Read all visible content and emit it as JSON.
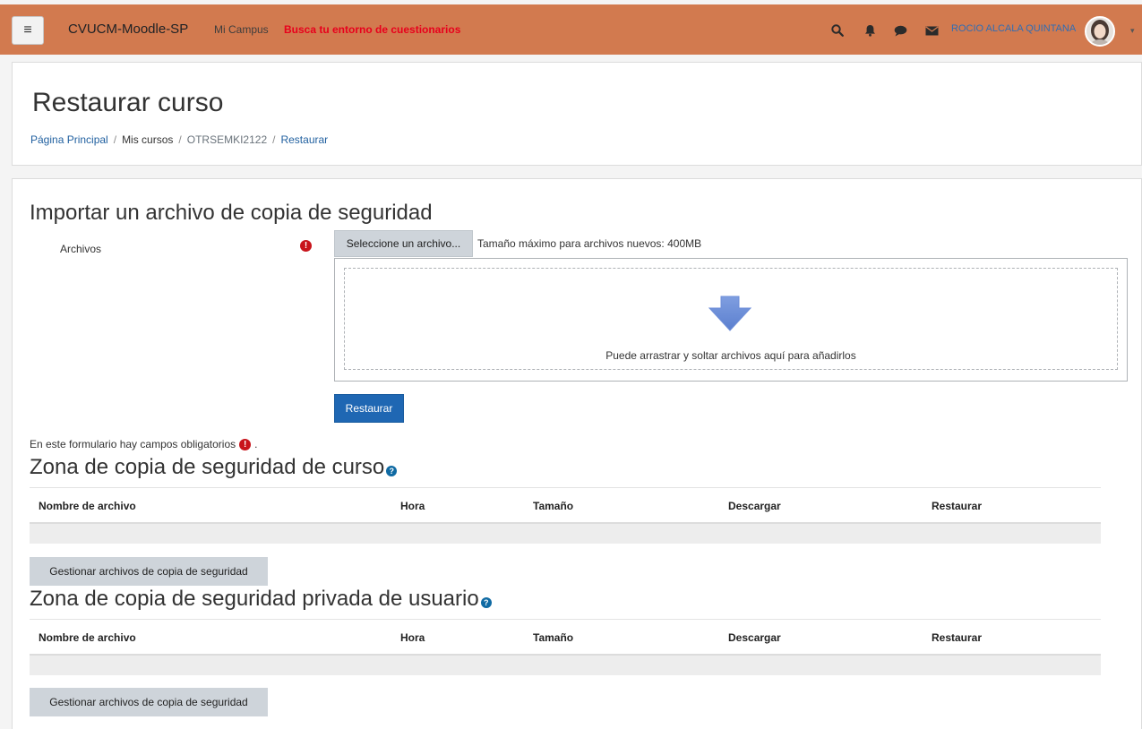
{
  "navbar": {
    "menu_icon": "menu-icon",
    "brand": "CVUCM-Moodle-SP",
    "mi_campus": "Mi Campus",
    "quiz_link": "Busca tu entorno de cuestionarios",
    "icons": [
      "search-icon",
      "bell-icon",
      "chat-icon",
      "envelope-icon"
    ],
    "user_name": "ROCIO ALCALA QUINTANA",
    "bg_color": "#d27a4f"
  },
  "header": {
    "title": "Restaurar curso",
    "breadcrumb": [
      "Página Principal",
      "Mis cursos",
      "OTRSEMKI2122",
      "Restaurar"
    ],
    "separator": "/"
  },
  "import": {
    "title": "Importar un archivo de copia de seguridad",
    "files_label": "Archivos",
    "select_button": "Seleccione un archivo...",
    "max_size": "Tamaño máximo para archivos nuevos: 400MB",
    "drop_text": "Puede arrastrar y soltar archivos aquí para añadirlos",
    "restore_button": "Restaurar",
    "required_note": "En este formulario hay campos obligatorios",
    "required_suffix": "."
  },
  "course_zone": {
    "title": "Zona de copia de seguridad de curso",
    "columns": [
      "Nombre de archivo",
      "Hora",
      "Tamaño",
      "Descargar",
      "Restaurar"
    ],
    "manage_button": "Gestionar archivos de copia de seguridad"
  },
  "user_zone": {
    "title": "Zona de copia de seguridad privada de usuario",
    "columns": [
      "Nombre de archivo",
      "Hora",
      "Tamaño",
      "Descargar",
      "Restaurar"
    ],
    "manage_button": "Gestionar archivos de copia de seguridad"
  }
}
